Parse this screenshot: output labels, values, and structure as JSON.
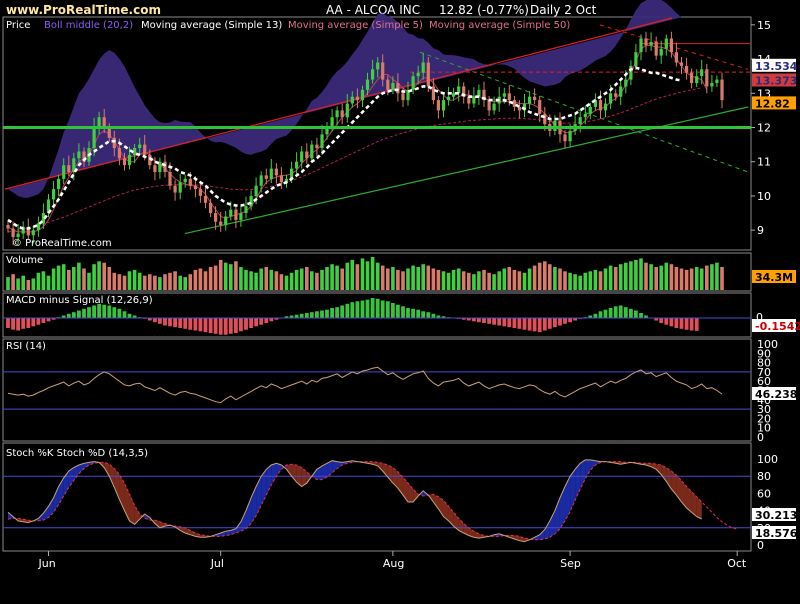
{
  "header": {
    "site": "www.ProRealTime.com",
    "symbol_title": "AA - ALCOA INC",
    "last_quote": "12.82 (-0.77%)",
    "period": "Daily  2 Oct"
  },
  "colors": {
    "background": "#000000",
    "panel_border": "#8a8a8a",
    "bollinger_fill": "#3b2a7a",
    "horizontal_line": "#2fc436",
    "candle_up": "#3fcf3f",
    "candle_down": "#d97a6a",
    "ma13": "#ffffff",
    "ma5": "#c0405a",
    "ma50": "#b02050",
    "macd_pos": "#39c23e",
    "macd_neg": "#e0505a",
    "stoch_k": "#c9a17a",
    "stoch_d": "#e03050",
    "stoch_up_fill": "#1a2aa0",
    "stoch_down_fill": "#7a2a1a",
    "label_box": "#ffe8a0",
    "badge_red": "#d23b3b",
    "badge_orange": "#ffa000"
  },
  "watermark": "© ProRealTime.com",
  "chart_data": [
    {
      "type": "candlestick",
      "panel": "price",
      "legend": [
        "Price",
        "Boll middle (20,2)",
        "Moving average (Simple 13)",
        "Moving average (Simple 5)",
        "Moving average (Simple 50)"
      ],
      "y_ticks": [
        9,
        10,
        11,
        12,
        13,
        14,
        15
      ],
      "ylim": [
        8.45,
        15.2
      ],
      "x_months": [
        "Jun",
        "Jul",
        "Aug",
        "Sep",
        "Oct"
      ],
      "month_index": [
        8,
        42,
        76,
        111,
        144
      ],
      "badges": {
        "last": "12.82",
        "ma13": "13.373",
        "ma_top": "13.534"
      },
      "horizontal_level": 12.0,
      "resistance_level": 14.45,
      "dashed_level": 13.62,
      "close": [
        9.05,
        8.8,
        8.9,
        9.1,
        8.85,
        9.0,
        9.2,
        9.5,
        9.9,
        10.2,
        10.5,
        10.9,
        10.7,
        11.1,
        11.3,
        11.0,
        11.4,
        12.0,
        12.3,
        12.0,
        11.7,
        11.4,
        11.1,
        10.9,
        11.2,
        11.4,
        11.5,
        11.2,
        10.9,
        10.7,
        11.0,
        10.7,
        10.3,
        10.1,
        10.4,
        10.5,
        10.3,
        10.2,
        10.0,
        9.8,
        9.5,
        9.25,
        9.15,
        9.4,
        9.6,
        9.3,
        9.5,
        9.7,
        10.0,
        10.3,
        10.6,
        10.5,
        10.8,
        10.6,
        10.4,
        10.5,
        10.8,
        11.0,
        11.3,
        11.1,
        11.5,
        11.4,
        11.8,
        12.0,
        12.3,
        12.5,
        12.3,
        12.7,
        12.9,
        12.8,
        13.1,
        13.4,
        13.7,
        13.9,
        13.4,
        13.1,
        13.3,
        13.0,
        12.8,
        13.1,
        13.5,
        13.6,
        13.9,
        13.2,
        12.8,
        12.5,
        12.8,
        12.9,
        13.0,
        13.2,
        12.9,
        12.7,
        12.9,
        13.1,
        12.8,
        12.5,
        12.7,
        12.9,
        13.0,
        12.8,
        12.6,
        12.5,
        12.7,
        12.9,
        12.8,
        12.4,
        12.1,
        11.9,
        12.2,
        11.8,
        11.6,
        11.9,
        12.1,
        12.3,
        12.4,
        12.6,
        12.8,
        12.5,
        12.7,
        13.0,
        12.9,
        13.2,
        13.4,
        13.8,
        14.2,
        14.6,
        14.4,
        14.5,
        14.1,
        14.3,
        14.6,
        14.2,
        13.9,
        13.8,
        13.6,
        13.3,
        13.5,
        13.7,
        13.2,
        13.3,
        13.4,
        12.8
      ],
      "ma13": [
        9.3,
        9.2,
        9.1,
        9.05,
        9.05,
        9.1,
        9.15,
        9.3,
        9.5,
        9.7,
        9.9,
        10.15,
        10.4,
        10.65,
        10.9,
        11.05,
        11.2,
        11.3,
        11.4,
        11.5,
        11.6,
        11.6,
        11.55,
        11.45,
        11.35,
        11.25,
        11.2,
        11.15,
        11.1,
        11.0,
        10.95,
        10.9,
        10.85,
        10.8,
        10.7,
        10.65,
        10.6,
        10.5,
        10.4,
        10.3,
        10.15,
        10.0,
        9.9,
        9.8,
        9.75,
        9.72,
        9.72,
        9.75,
        9.8,
        9.9,
        10.0,
        10.1,
        10.2,
        10.3,
        10.35,
        10.4,
        10.5,
        10.6,
        10.7,
        10.85,
        11.0,
        11.1,
        11.25,
        11.4,
        11.55,
        11.7,
        11.85,
        12.0,
        12.15,
        12.3,
        12.45,
        12.6,
        12.75,
        12.9,
        13.0,
        13.05,
        13.1,
        13.1,
        13.05,
        13.05,
        13.1,
        13.15,
        13.2,
        13.2,
        13.1,
        13.05,
        13.0,
        13.0,
        13.0,
        13.0,
        12.95,
        12.9,
        12.9,
        12.9,
        12.85,
        12.8,
        12.8,
        12.8,
        12.8,
        12.75,
        12.7,
        12.6,
        12.55,
        12.45,
        12.4,
        12.35,
        12.3,
        12.25,
        12.25,
        12.25,
        12.3,
        12.35,
        12.4,
        12.5,
        12.6,
        12.7,
        12.8,
        12.9,
        13.0,
        13.1,
        13.25,
        13.4,
        13.55,
        13.7,
        13.75,
        13.7,
        13.65,
        13.6,
        13.6,
        13.55,
        13.5,
        13.45,
        13.4,
        13.373
      ],
      "ma5": [
        9.1,
        9.0,
        8.95,
        8.95,
        8.95,
        8.95,
        9.0,
        9.1,
        9.3,
        9.6,
        9.95,
        10.3,
        10.55,
        10.8,
        11.0,
        11.1,
        11.2,
        11.5,
        11.8,
        11.9,
        11.8,
        11.6,
        11.35,
        11.1,
        11.0,
        11.0,
        11.2,
        11.3,
        11.2,
        11.0,
        10.9,
        10.8,
        10.65,
        10.5,
        10.4,
        10.35,
        10.3,
        10.3,
        10.2,
        10.05,
        9.8,
        9.6,
        9.4,
        9.35,
        9.4,
        9.45,
        9.5,
        9.55,
        9.7,
        9.9,
        10.2,
        10.4,
        10.5,
        10.55,
        10.6,
        10.6,
        10.65,
        10.75,
        10.95,
        11.1,
        11.25,
        11.35,
        11.5,
        11.7,
        11.9,
        12.1,
        12.3,
        12.45,
        12.6,
        12.7,
        12.85,
        13.0,
        13.2,
        13.4,
        13.55,
        13.55,
        13.4,
        13.3,
        13.15,
        13.05,
        13.15,
        13.3,
        13.45,
        13.45,
        13.3,
        13.1,
        12.95,
        12.8,
        12.8,
        12.9,
        12.95,
        12.95,
        12.9,
        12.9,
        12.85,
        12.8,
        12.75,
        12.75,
        12.75,
        12.75,
        12.75,
        12.7,
        12.7,
        12.7,
        12.65,
        12.55,
        12.4,
        12.25,
        12.05,
        11.95,
        11.85,
        11.85,
        11.9,
        12.05,
        12.2,
        12.4,
        12.5,
        12.55,
        12.6,
        12.75,
        12.85,
        13.0,
        13.25,
        13.55,
        13.95,
        14.3,
        14.4,
        14.4,
        14.35,
        14.35,
        14.3,
        14.2,
        14.0,
        13.8,
        13.6,
        13.5,
        13.45,
        13.4,
        13.1
      ],
      "ma50": [
        8.95,
        8.97,
        9.0,
        9.03,
        9.06,
        9.1,
        9.14,
        9.18,
        9.23,
        9.28,
        9.33,
        9.38,
        9.44,
        9.5,
        9.56,
        9.62,
        9.68,
        9.74,
        9.8,
        9.86,
        9.92,
        9.98,
        10.03,
        10.08,
        10.13,
        10.17,
        10.2,
        10.23,
        10.26,
        10.28,
        10.3,
        10.31,
        10.32,
        10.33,
        10.33,
        10.33,
        10.33,
        10.32,
        10.31,
        10.3,
        10.28,
        10.26,
        10.24,
        10.22,
        10.2,
        10.19,
        10.18,
        10.18,
        10.19,
        10.2,
        10.22,
        10.25,
        10.28,
        10.32,
        10.36,
        10.4,
        10.45,
        10.5,
        10.56,
        10.62,
        10.68,
        10.75,
        10.82,
        10.89,
        10.96,
        11.03,
        11.1,
        11.17,
        11.24,
        11.31,
        11.38,
        11.45,
        11.52,
        11.59,
        11.65,
        11.7,
        11.75,
        11.8,
        11.84,
        11.88,
        11.92,
        11.96,
        12.0,
        12.03,
        12.06,
        12.08,
        12.1,
        12.12,
        12.14,
        12.16,
        12.18,
        12.2,
        12.21,
        12.22,
        12.23,
        12.24,
        12.25,
        12.26,
        12.27,
        12.27,
        12.27,
        12.27,
        12.26,
        12.25,
        12.24,
        12.22,
        12.2,
        12.18,
        12.16,
        12.14,
        12.13,
        12.13,
        12.14,
        12.15,
        12.17,
        12.19,
        12.22,
        12.25,
        12.29,
        12.33,
        12.38,
        12.43,
        12.48,
        12.54,
        12.6,
        12.66,
        12.72,
        12.78,
        12.83,
        12.88,
        12.92,
        12.96,
        13.0,
        13.04,
        13.07,
        13.1,
        13.13,
        13.16
      ]
    },
    {
      "type": "bar",
      "panel": "volume",
      "title": "Volume",
      "badge": "34.3M",
      "values": [
        0.9,
        1.1,
        0.8,
        1.0,
        0.7,
        0.8,
        1.2,
        1.3,
        1.0,
        1.5,
        1.7,
        1.8,
        1.4,
        1.6,
        1.9,
        1.5,
        1.2,
        1.8,
        2.0,
        1.9,
        1.6,
        1.2,
        1.1,
        1.0,
        1.3,
        1.4,
        1.2,
        1.0,
        1.1,
        1.0,
        0.9,
        1.1,
        1.2,
        1.3,
        1.0,
        0.9,
        1.1,
        1.4,
        1.5,
        1.3,
        1.6,
        1.7,
        2.1,
        1.9,
        1.8,
        2.0,
        1.6,
        1.4,
        1.3,
        1.2,
        1.5,
        1.6,
        1.4,
        1.3,
        1.1,
        1.0,
        1.2,
        1.4,
        1.5,
        1.6,
        1.3,
        1.2,
        1.4,
        1.6,
        1.8,
        1.7,
        1.5,
        1.9,
        2.1,
        1.8,
        2.2,
        2.0,
        2.3,
        1.9,
        1.7,
        1.5,
        1.6,
        1.4,
        1.3,
        1.5,
        1.7,
        1.6,
        1.8,
        1.7,
        1.5,
        1.4,
        1.3,
        1.2,
        1.4,
        1.5,
        1.3,
        1.2,
        1.1,
        1.3,
        1.4,
        1.2,
        1.1,
        1.3,
        1.5,
        1.6,
        1.4,
        1.3,
        1.2,
        1.5,
        1.7,
        1.9,
        2.0,
        1.8,
        1.6,
        1.5,
        1.3,
        1.2,
        1.1,
        1.0,
        1.2,
        1.3,
        1.4,
        1.3,
        1.5,
        1.7,
        1.6,
        1.8,
        1.9,
        2.0,
        2.1,
        2.2,
        1.9,
        1.8,
        1.6,
        1.7,
        1.9,
        1.8,
        1.6,
        1.5,
        1.4,
        1.5,
        1.6,
        1.5,
        1.7,
        1.8,
        1.9,
        1.6
      ]
    },
    {
      "type": "bar",
      "panel": "macd",
      "title": "MACD minus Signal (12,26,9)",
      "badge": "-0.1542",
      "values": [
        -0.12,
        -0.14,
        -0.15,
        -0.13,
        -0.12,
        -0.1,
        -0.08,
        -0.06,
        -0.04,
        -0.02,
        0.01,
        0.03,
        0.05,
        0.07,
        0.09,
        0.11,
        0.13,
        0.15,
        0.17,
        0.16,
        0.15,
        0.13,
        0.11,
        0.08,
        0.05,
        0.03,
        0.01,
        -0.01,
        -0.03,
        -0.05,
        -0.07,
        -0.09,
        -0.1,
        -0.11,
        -0.12,
        -0.13,
        -0.14,
        -0.15,
        -0.16,
        -0.17,
        -0.18,
        -0.19,
        -0.2,
        -0.2,
        -0.19,
        -0.18,
        -0.16,
        -0.14,
        -0.12,
        -0.1,
        -0.08,
        -0.06,
        -0.04,
        -0.02,
        0.0,
        0.02,
        0.03,
        0.04,
        0.05,
        0.06,
        0.07,
        0.08,
        0.09,
        0.1,
        0.12,
        0.13,
        0.15,
        0.17,
        0.19,
        0.2,
        0.21,
        0.22,
        0.24,
        0.23,
        0.21,
        0.2,
        0.18,
        0.16,
        0.14,
        0.12,
        0.11,
        0.1,
        0.08,
        0.07,
        0.05,
        0.03,
        0.02,
        0.01,
        0.0,
        -0.01,
        -0.02,
        -0.03,
        -0.04,
        -0.05,
        -0.06,
        -0.07,
        -0.08,
        -0.09,
        -0.1,
        -0.11,
        -0.12,
        -0.13,
        -0.14,
        -0.15,
        -0.16,
        -0.17,
        -0.15,
        -0.13,
        -0.11,
        -0.09,
        -0.07,
        -0.05,
        -0.03,
        -0.01,
        0.01,
        0.03,
        0.05,
        0.08,
        0.1,
        0.12,
        0.14,
        0.15,
        0.13,
        0.11,
        0.09,
        0.06,
        0.03,
        0.0,
        -0.03,
        -0.06,
        -0.08,
        -0.1,
        -0.12,
        -0.13,
        -0.14,
        -0.15,
        -0.1542
      ],
      "ylim": [
        -0.3,
        0.3
      ]
    },
    {
      "type": "line",
      "panel": "rsi",
      "title": "RSI (14)",
      "badge": "46.238",
      "y_ticks": [
        0,
        10,
        20,
        30,
        40,
        50,
        60,
        70,
        80,
        90,
        100
      ],
      "ylim": [
        0,
        100
      ],
      "levels": [
        30,
        70
      ],
      "values": [
        47,
        46,
        45,
        46,
        44,
        45,
        48,
        50,
        53,
        55,
        57,
        59,
        55,
        58,
        60,
        56,
        58,
        63,
        67,
        70,
        68,
        64,
        60,
        56,
        55,
        57,
        58,
        54,
        52,
        50,
        53,
        50,
        47,
        45,
        48,
        49,
        47,
        46,
        44,
        42,
        40,
        38,
        37,
        41,
        44,
        40,
        43,
        46,
        49,
        52,
        55,
        53,
        57,
        55,
        52,
        54,
        56,
        58,
        60,
        57,
        61,
        59,
        63,
        64,
        66,
        68,
        64,
        67,
        70,
        68,
        71,
        72,
        74,
        75,
        71,
        67,
        69,
        65,
        62,
        65,
        68,
        69,
        71,
        63,
        58,
        55,
        59,
        60,
        61,
        63,
        58,
        55,
        57,
        59,
        55,
        52,
        54,
        56,
        57,
        55,
        53,
        52,
        54,
        56,
        55,
        51,
        48,
        46,
        49,
        45,
        43,
        46,
        49,
        52,
        54,
        56,
        58,
        54,
        57,
        60,
        58,
        61,
        63,
        67,
        70,
        72,
        68,
        69,
        65,
        67,
        69,
        64,
        60,
        58,
        56,
        52,
        54,
        57,
        52,
        53,
        50,
        46.238
      ]
    },
    {
      "type": "line",
      "panel": "stochastic",
      "title": "Stoch %K Stoch %D (14,3,5)",
      "badge_k": "30.213",
      "badge_d": "18.576",
      "y_ticks": [
        0,
        20,
        40,
        60,
        80,
        100
      ],
      "ylim": [
        0,
        100
      ],
      "levels": [
        20,
        80
      ],
      "k": [
        38,
        33,
        28,
        27,
        26,
        28,
        31,
        37,
        45,
        55,
        68,
        78,
        86,
        90,
        93,
        95,
        96,
        97,
        96,
        90,
        80,
        67,
        53,
        40,
        28,
        24,
        30,
        36,
        32,
        25,
        20,
        22,
        23,
        21,
        17,
        14,
        12,
        10,
        9,
        9,
        10,
        12,
        14,
        16,
        17,
        19,
        27,
        40,
        55,
        68,
        80,
        88,
        93,
        95,
        93,
        88,
        80,
        73,
        68,
        72,
        80,
        88,
        92,
        95,
        98,
        97,
        96,
        97,
        98,
        97,
        96,
        95,
        94,
        92,
        86,
        79,
        72,
        66,
        58,
        50,
        50,
        57,
        63,
        58,
        50,
        42,
        33,
        28,
        22,
        17,
        14,
        11,
        9,
        8,
        9,
        10,
        12,
        13,
        11,
        9,
        7,
        5,
        4,
        6,
        9,
        12,
        18,
        28,
        40,
        55,
        68,
        80,
        88,
        95,
        99,
        99,
        98,
        97,
        97,
        96,
        95,
        94,
        95,
        96,
        95,
        94,
        93,
        91,
        88,
        82,
        74,
        65,
        58,
        50,
        43,
        38,
        33,
        30.213
      ],
      "d": [
        30,
        31,
        31,
        30,
        29,
        28,
        28,
        29,
        32,
        38,
        47,
        57,
        67,
        75,
        83,
        89,
        93,
        95,
        96,
        96,
        94,
        89,
        82,
        72,
        59,
        46,
        36,
        31,
        29,
        29,
        27,
        25,
        23,
        22,
        21,
        20,
        17,
        14,
        12,
        11,
        10,
        10,
        10,
        11,
        12,
        14,
        16,
        19,
        25,
        34,
        46,
        58,
        70,
        80,
        88,
        93,
        94,
        93,
        90,
        85,
        80,
        76,
        76,
        79,
        84,
        89,
        93,
        95,
        96,
        97,
        97,
        97,
        97,
        96,
        95,
        93,
        90,
        85,
        79,
        72,
        65,
        59,
        57,
        58,
        59,
        56,
        52,
        45,
        38,
        31,
        25,
        20,
        16,
        13,
        11,
        10,
        10,
        10,
        11,
        11,
        11,
        10,
        8,
        7,
        6,
        6,
        7,
        9,
        13,
        19,
        28,
        39,
        52,
        65,
        77,
        87,
        93,
        96,
        97,
        97,
        97,
        97,
        96,
        96,
        96,
        95,
        95,
        95,
        94,
        93,
        90,
        86,
        81,
        75,
        68,
        62,
        56,
        50,
        44,
        38,
        32,
        27,
        23,
        20,
        18.576
      ]
    }
  ]
}
